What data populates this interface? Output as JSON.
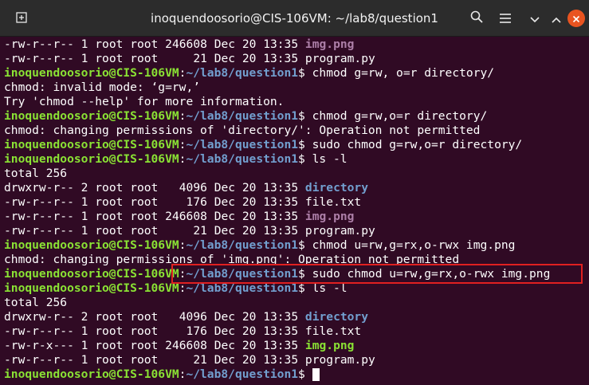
{
  "window": {
    "title": "inoquendoosorio@CIS-106VM: ~/lab8/question1",
    "buttons": {
      "new_tab_icon": "new-tab-icon",
      "search_icon": "search-icon",
      "menu_icon": "hamburger-menu-icon",
      "minimize_icon": "minimize-icon",
      "maximize_icon": "chevron-up-icon",
      "close_icon": "close-icon"
    },
    "colors": {
      "background": "#300a24",
      "prompt_user": "#8ae234",
      "prompt_path": "#729fcf",
      "directory": "#729fcf",
      "image": "#ad7fa8",
      "executable": "#8ae234",
      "highlight_border": "#e02020"
    }
  },
  "prompt": {
    "user_host": "inoquendoosorio@CIS-106VM",
    "path": "~/lab8/question1"
  },
  "lines": [
    {
      "type": "file",
      "perms": "-rw-r--r--",
      "links": "1",
      "owner": "root",
      "group": "root",
      "size": "246608",
      "date": "Dec 20 13:35",
      "name": "img.png",
      "name_class": "img"
    },
    {
      "type": "file",
      "perms": "-rw-r--r--",
      "links": "1",
      "owner": "root",
      "group": "root",
      "size": "21",
      "date": "Dec 20 13:35",
      "name": "program.py",
      "name_class": "plain"
    },
    {
      "type": "prompt",
      "cmd": "chmod g=rw, o=r directory/"
    },
    {
      "type": "text",
      "text": "chmod: invalid mode: ‘g=rw,’"
    },
    {
      "type": "text",
      "text": "Try 'chmod --help' for more information."
    },
    {
      "type": "prompt",
      "cmd": "chmod g=rw,o=r directory/"
    },
    {
      "type": "text",
      "text": "chmod: changing permissions of 'directory/': Operation not permitted"
    },
    {
      "type": "prompt",
      "cmd": "sudo chmod g=rw,o=r directory/"
    },
    {
      "type": "prompt",
      "cmd": "ls -l"
    },
    {
      "type": "text",
      "text": "total 256"
    },
    {
      "type": "file",
      "perms": "drwxrw-r--",
      "links": "2",
      "owner": "root",
      "group": "root",
      "size": "4096",
      "date": "Dec 20 13:35",
      "name": "directory",
      "name_class": "dir"
    },
    {
      "type": "file",
      "perms": "-rw-r--r--",
      "links": "1",
      "owner": "root",
      "group": "root",
      "size": "176",
      "date": "Dec 20 13:35",
      "name": "file.txt",
      "name_class": "plain"
    },
    {
      "type": "file",
      "perms": "-rw-r--r--",
      "links": "1",
      "owner": "root",
      "group": "root",
      "size": "246608",
      "date": "Dec 20 13:35",
      "name": "img.png",
      "name_class": "img"
    },
    {
      "type": "file",
      "perms": "-rw-r--r--",
      "links": "1",
      "owner": "root",
      "group": "root",
      "size": "21",
      "date": "Dec 20 13:35",
      "name": "program.py",
      "name_class": "plain"
    },
    {
      "type": "prompt",
      "cmd": "chmod u=rw,g=rx,o-rwx img.png"
    },
    {
      "type": "text",
      "text": "chmod: changing permissions of 'img.png': Operation not permitted"
    },
    {
      "type": "prompt",
      "cmd": "sudo chmod u=rw,g=rx,o-rwx img.png",
      "highlighted": true
    },
    {
      "type": "prompt",
      "cmd": "ls -l"
    },
    {
      "type": "text",
      "text": "total 256"
    },
    {
      "type": "file",
      "perms": "drwxrw-r--",
      "links": "2",
      "owner": "root",
      "group": "root",
      "size": "4096",
      "date": "Dec 20 13:35",
      "name": "directory",
      "name_class": "dir"
    },
    {
      "type": "file",
      "perms": "-rw-r--r--",
      "links": "1",
      "owner": "root",
      "group": "root",
      "size": "176",
      "date": "Dec 20 13:35",
      "name": "file.txt",
      "name_class": "plain"
    },
    {
      "type": "file",
      "perms": "-rw-r-x---",
      "links": "1",
      "owner": "root",
      "group": "root",
      "size": "246608",
      "date": "Dec 20 13:35",
      "name": "img.png",
      "name_class": "exe"
    },
    {
      "type": "file",
      "perms": "-rw-r--r--",
      "links": "1",
      "owner": "root",
      "group": "root",
      "size": "21",
      "date": "Dec 20 13:35",
      "name": "program.py",
      "name_class": "plain"
    },
    {
      "type": "prompt",
      "cmd": "",
      "cursor": true
    }
  ]
}
